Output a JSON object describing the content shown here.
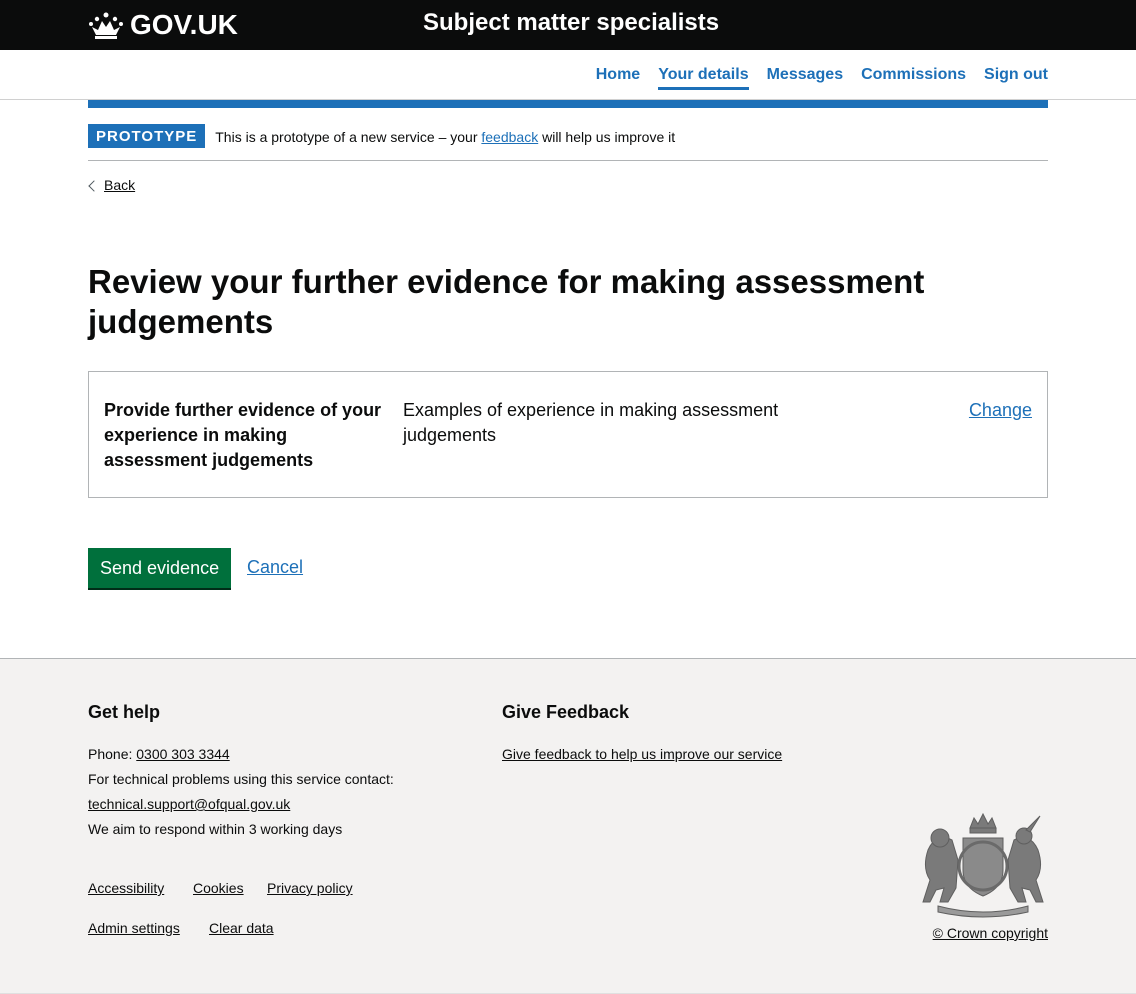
{
  "header": {
    "logo_text": "GOV.UK",
    "service_name": "Subject matter specialists"
  },
  "nav": {
    "items": [
      {
        "label": "Home",
        "active": false
      },
      {
        "label": "Your details",
        "active": true
      },
      {
        "label": "Messages",
        "active": false
      },
      {
        "label": "Commissions",
        "active": false
      },
      {
        "label": "Sign out",
        "active": false
      }
    ]
  },
  "phase_banner": {
    "tag": "PROTOTYPE",
    "text_before": "This is a prototype of a new service – your ",
    "link": "feedback",
    "text_after": " will help us improve it"
  },
  "back_link": "Back",
  "page_title": "Review your further evidence for making assessment judgements",
  "summary": {
    "key": "Provide further evidence of your experience in making assessment judgements",
    "value": "Examples of experience in making assessment judgements",
    "action": "Change"
  },
  "actions": {
    "submit": "Send evidence",
    "cancel": "Cancel"
  },
  "footer": {
    "help": {
      "heading": "Get help",
      "phone_label": "Phone: ",
      "phone": "0300 303 3344",
      "tech_text": "For technical problems using this service contact:",
      "email": "technical.support@ofqual.gov.uk",
      "respond": "We aim to respond within 3 working days"
    },
    "feedback": {
      "heading": "Give Feedback",
      "link": "Give feedback to help us improve our service"
    },
    "links": [
      "Accessibility",
      "Cookies",
      "Privacy policy"
    ],
    "links2": [
      "Admin settings",
      "Clear data"
    ],
    "copyright": "© Crown copyright"
  },
  "colors": {
    "header_bg": "#0b0c0c",
    "link": "#1d70b8",
    "button": "#00703c",
    "footer_bg": "#f3f2f1"
  }
}
